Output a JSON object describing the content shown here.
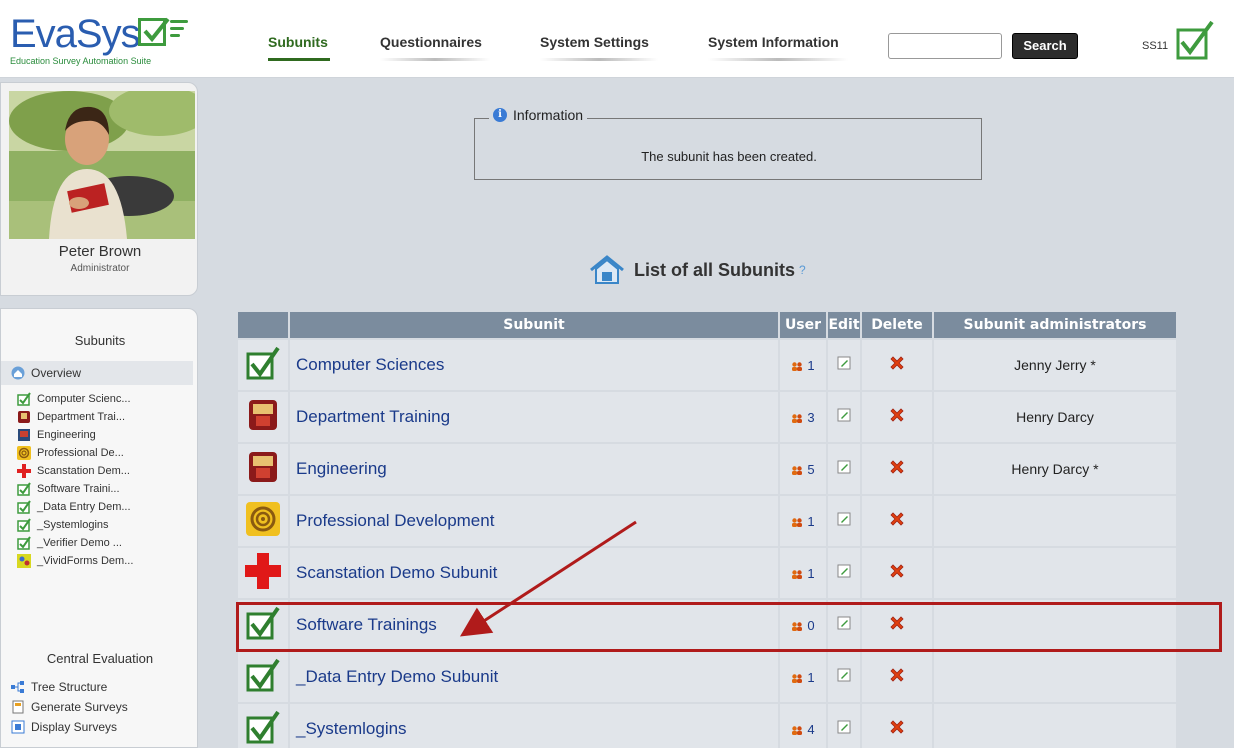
{
  "header": {
    "logo_name": "EvaSys",
    "logo_tagline": "Education Survey Automation Suite",
    "nav": [
      {
        "label": "Subunits"
      },
      {
        "label": "Questionnaires"
      },
      {
        "label": "System Settings"
      },
      {
        "label": "System Information"
      }
    ],
    "search_value": "",
    "search_button": "Search",
    "semester": "SS11"
  },
  "profile": {
    "name": "Peter Brown",
    "role": "Administrator"
  },
  "sidebar": {
    "subunits_heading": "Subunits",
    "overview_label": "Overview",
    "subunits": [
      {
        "label": "Computer Scienc...",
        "icon": "checkmark-icon"
      },
      {
        "label": "Department Trai...",
        "icon": "crest-icon"
      },
      {
        "label": "Engineering",
        "icon": "crest-icon"
      },
      {
        "label": "Professional De...",
        "icon": "spiral-icon"
      },
      {
        "label": "Scanstation Dem...",
        "icon": "red-cross-icon"
      },
      {
        "label": "Software Traini...",
        "icon": "checkmark-icon"
      },
      {
        "label": "_Data Entry Dem...",
        "icon": "checkmark-icon"
      },
      {
        "label": "_Systemlogins",
        "icon": "checkmark-icon"
      },
      {
        "label": "_Verifier Demo ...",
        "icon": "checkmark-icon"
      },
      {
        "label": "_VividForms Dem...",
        "icon": "vividforms-icon"
      }
    ],
    "central_heading": "Central Evaluation",
    "central_items": [
      {
        "label": "Tree Structure",
        "icon": "tree-icon"
      },
      {
        "label": "Generate Surveys",
        "icon": "document-icon"
      },
      {
        "label": "Display Surveys",
        "icon": "display-icon"
      }
    ]
  },
  "info": {
    "legend": "Information",
    "message": "The subunit has been created."
  },
  "list": {
    "title": "List of all Subunits",
    "help": "?",
    "columns": [
      "Subunit",
      "User",
      "Edit",
      "Delete",
      "Subunit administrators"
    ],
    "rows": [
      {
        "name": "Computer Sciences",
        "users": "1",
        "admins": "Jenny Jerry *",
        "icon": "checkmark-icon"
      },
      {
        "name": "Department Training",
        "users": "3",
        "admins": "Henry Darcy",
        "icon": "crest-icon"
      },
      {
        "name": "Engineering",
        "users": "5",
        "admins": "Henry Darcy *",
        "icon": "crest-icon"
      },
      {
        "name": "Professional Development",
        "users": "1",
        "admins": "",
        "icon": "spiral-icon"
      },
      {
        "name": "Scanstation Demo Subunit",
        "users": "1",
        "admins": "",
        "icon": "red-cross-icon"
      },
      {
        "name": "Software Trainings",
        "users": "0",
        "admins": "",
        "icon": "checkmark-icon"
      },
      {
        "name": "_Data Entry Demo Subunit",
        "users": "1",
        "admins": "",
        "icon": "checkmark-icon"
      },
      {
        "name": "_Systemlogins",
        "users": "4",
        "admins": "",
        "icon": "checkmark-icon"
      }
    ]
  },
  "colors": {
    "accent_green": "#3e9b3e",
    "header_cell": "#7b8c9e",
    "link_blue": "#1a3a8a",
    "highlight_red": "#b01b1b"
  }
}
